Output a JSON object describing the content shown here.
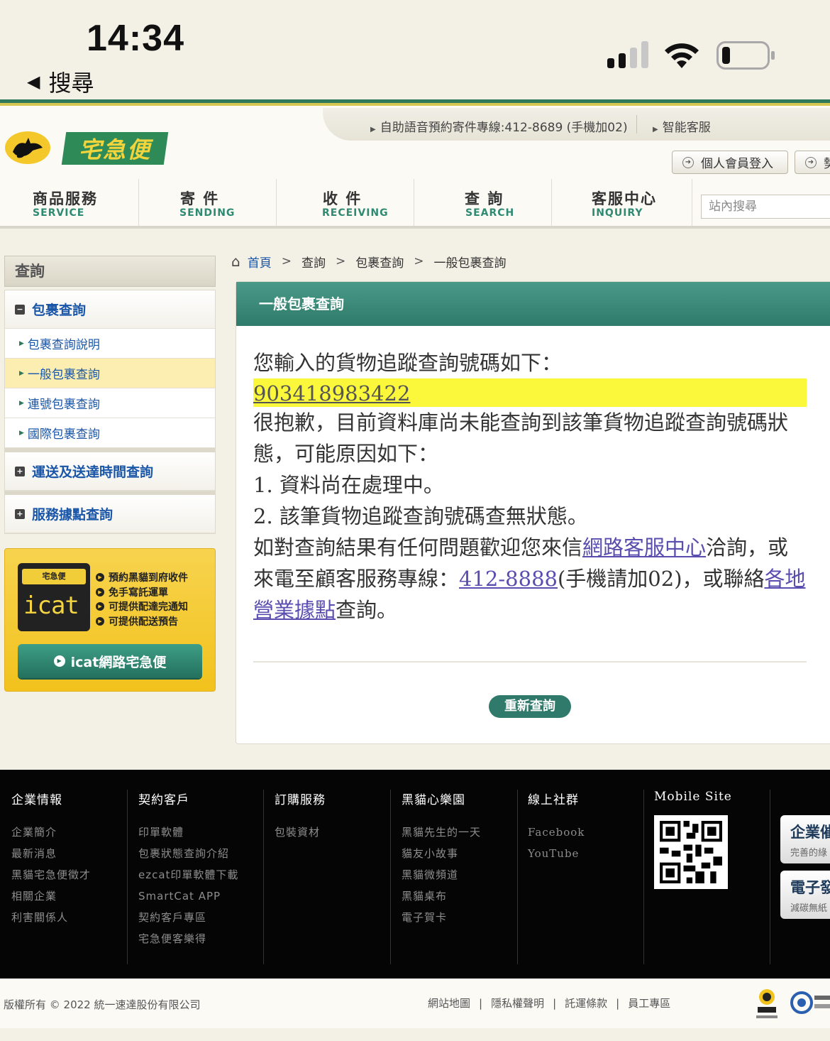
{
  "status_bar": {
    "time": "14:34",
    "back_label": "搜尋"
  },
  "header": {
    "logo_text": "宅急便",
    "top_links": [
      "自助語音預約寄件專線:412-8689 (手機加02)",
      "智能客服"
    ],
    "buttons": [
      "個人會員登入",
      "勢"
    ],
    "nav": [
      {
        "zh": "商品服務",
        "en": "SERVICE"
      },
      {
        "zh": "寄 件",
        "en": "SENDING"
      },
      {
        "zh": "收 件",
        "en": "RECEIVING"
      },
      {
        "zh": "查 詢",
        "en": "SEARCH"
      },
      {
        "zh": "客服中心",
        "en": "INQUIRY"
      }
    ],
    "search_placeholder": "站內搜尋"
  },
  "sidebar": {
    "title": "查詢",
    "groups": [
      {
        "label": "包裹查詢",
        "icon": "minus-icon",
        "items": [
          "包裹查詢說明",
          "一般包裹查詢",
          "連號包裹查詢",
          "國際包裹查詢"
        ],
        "active_item": "一般包裹查詢"
      },
      {
        "label": "運送及送達時間查詢",
        "icon": "plus-icon"
      },
      {
        "label": "服務據點查詢",
        "icon": "plus-icon"
      }
    ],
    "promo": {
      "mini_logo": "宅急便",
      "brand": "icat",
      "features": [
        "預約黑貓到府收件",
        "免手寫託運單",
        "可提供配達完通知",
        "可提供配送預告"
      ],
      "button_label": "icat網路宅急便"
    }
  },
  "breadcrumb": [
    "首頁",
    "查詢",
    "包裹查詢",
    "一般包裹查詢"
  ],
  "panel": {
    "title": "一般包裹查詢",
    "intro": "您輸入的貨物追蹤查詢號碼如下：",
    "tracking_number": "903418983422",
    "sorry": "很抱歉，目前資料庫尚未能查詢到該筆貨物追蹤查詢號碼狀態，可能原因如下：",
    "reason1": "1. 資料尚在處理中。",
    "reason2": "2. 該筆貨物追蹤查詢號碼查無狀態。",
    "contact_pre": "如對查詢結果有任何問題歡迎您來信",
    "contact_link1": "網路客服中心",
    "contact_mid1": "洽詢，或來電至顧客服務專線：",
    "phone": "412-8888",
    "contact_mid2": "(手機請加02)，或聯絡",
    "contact_link2": "各地營業據點",
    "contact_end": "查詢。",
    "retry_label": "重新查詢"
  },
  "footer": {
    "columns": [
      {
        "title": "企業情報",
        "links": [
          "企業簡介",
          "最新消息",
          "黑貓宅急便徵才",
          "相關企業",
          "利害關係人"
        ]
      },
      {
        "title": "契約客戶",
        "links": [
          "印單軟體",
          "包裹狀態查詢介紹",
          "ezcat印單軟體下載",
          "SmartCat APP",
          "契約客戶專區",
          "宅急便客樂得"
        ]
      },
      {
        "title": "訂購服務",
        "links": [
          "包裝資材"
        ]
      },
      {
        "title": "黑貓心樂園",
        "links": [
          "黑貓先生的一天",
          "貓友小故事",
          "黑貓微頻道",
          "黑貓桌布",
          "電子賀卡"
        ]
      },
      {
        "title": "線上社群",
        "links": [
          "Facebook",
          "YouTube"
        ]
      },
      {
        "title": "Mobile Site",
        "links": []
      }
    ],
    "cards": [
      {
        "big": "企業催",
        "small": "完善的綠"
      },
      {
        "big": "電子發",
        "small": "減碳無紙"
      }
    ],
    "copyright": "版權所有 © 2022 統一速達股份有限公司",
    "bottom_links": [
      "網站地圖",
      "隱私權聲明",
      "託運條款",
      "員工專區"
    ]
  }
}
